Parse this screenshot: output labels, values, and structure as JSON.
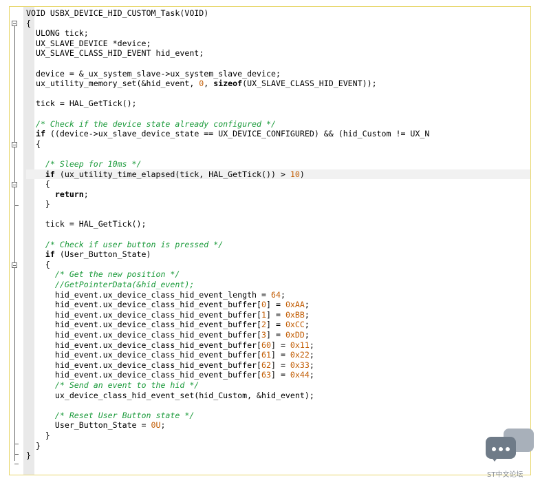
{
  "code_lines": [
    {
      "text": "VOID USBX_DEVICE_HID_CUSTOM_Task(VOID)"
    },
    {
      "text": "{"
    },
    {
      "text": "  ULONG tick;"
    },
    {
      "text": "  UX_SLAVE_DEVICE *device;"
    },
    {
      "text": "  UX_SLAVE_CLASS_HID_EVENT hid_event;"
    },
    {
      "text": ""
    },
    {
      "text": "  device = &_ux_system_slave->ux_system_slave_device;"
    },
    {
      "text": "  ux_utility_memory_set(&hid_event, 0, sizeof(UX_SLAVE_CLASS_HID_EVENT));"
    },
    {
      "text": ""
    },
    {
      "text": "  tick = HAL_GetTick();"
    },
    {
      "text": ""
    },
    {
      "text": "  /* Check if the device state already configured */"
    },
    {
      "text": "  if ((device->ux_slave_device_state == UX_DEVICE_CONFIGURED) && (hid_Custom != UX_N"
    },
    {
      "text": "  {"
    },
    {
      "text": ""
    },
    {
      "text": "    /* Sleep for 10ms */"
    },
    {
      "text": "    if (ux_utility_time_elapsed(tick, HAL_GetTick()) > 10)"
    },
    {
      "text": "    {"
    },
    {
      "text": "      return;"
    },
    {
      "text": "    }"
    },
    {
      "text": ""
    },
    {
      "text": "    tick = HAL_GetTick();"
    },
    {
      "text": ""
    },
    {
      "text": "    /* Check if user button is pressed */"
    },
    {
      "text": "    if (User_Button_State)"
    },
    {
      "text": "    {"
    },
    {
      "text": "      /* Get the new position */"
    },
    {
      "text": "      //GetPointerData(&hid_event);"
    },
    {
      "text": "      hid_event.ux_device_class_hid_event_length = 64;"
    },
    {
      "text": "      hid_event.ux_device_class_hid_event_buffer[0] = 0xAA;"
    },
    {
      "text": "      hid_event.ux_device_class_hid_event_buffer[1] = 0xBB;"
    },
    {
      "text": "      hid_event.ux_device_class_hid_event_buffer[2] = 0xCC;"
    },
    {
      "text": "      hid_event.ux_device_class_hid_event_buffer[3] = 0xDD;"
    },
    {
      "text": "      hid_event.ux_device_class_hid_event_buffer[60] = 0x11;"
    },
    {
      "text": "      hid_event.ux_device_class_hid_event_buffer[61] = 0x22;"
    },
    {
      "text": "      hid_event.ux_device_class_hid_event_buffer[62] = 0x33;"
    },
    {
      "text": "      hid_event.ux_device_class_hid_event_buffer[63] = 0x44;"
    },
    {
      "text": "      /* Send an event to the hid */"
    },
    {
      "text": "      ux_device_class_hid_event_set(hid_Custom, &hid_event);"
    },
    {
      "text": ""
    },
    {
      "text": "      /* Reset User Button state */"
    },
    {
      "text": "      User_Button_State = 0U;"
    },
    {
      "text": "    }"
    },
    {
      "text": "  }"
    },
    {
      "text": "}"
    }
  ],
  "watermark": {
    "text": "ST中文论坛"
  },
  "colors": {
    "comment": "#1a9a3a",
    "number": "#c15b00",
    "border": "#e8d66a"
  }
}
